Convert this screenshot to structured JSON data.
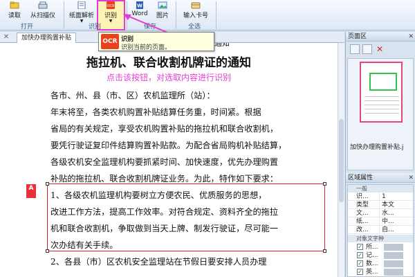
{
  "ribbon": {
    "buttons": [
      {
        "label": "读取",
        "icon": "read-icon"
      },
      {
        "label": "从扫描仪",
        "icon": "scanner-icon"
      },
      {
        "label": "纸面解析",
        "icon": "page-parse-icon"
      },
      {
        "label": "识别",
        "icon": "ocr-icon"
      },
      {
        "label": "Word",
        "icon": "word-icon"
      },
      {
        "label": "图片",
        "icon": "image-icon"
      },
      {
        "label": "输入卡号",
        "icon": "card-icon"
      }
    ],
    "groups": {
      "open": "打开",
      "recognize": "识别",
      "save": "保存",
      "select_all": "全选"
    }
  },
  "tooltip": {
    "badge": "OCR",
    "title": "识别",
    "desc": "识别当前的页面。"
  },
  "tab": {
    "label": "加快办理购置补贴"
  },
  "document": {
    "title": "拖拉机、联合收割机牌证的通知",
    "hint": "点击该按钮，对选取内容进行识别",
    "top_cut": "通知",
    "lines": [
      "各市、州、县（市、区）农机监理所（站）：",
      "    年末将至，各类农机购置补贴结算任务重，时间紧。根据",
      "省局的有关规定，享受农机购置补贴的拖拉机和联合收割机，",
      "要凭行驶证复印件结算购置补贴款。为配合省局购机补贴结算，",
      "各级农机安全监理机构要抓紧时间、加快速度，优先办理购置",
      "补贴的拖拉机、联合收割机牌证业务。为此，特作如下要求：",
      "    1、各级农机监理机构要树立方便农民、优质服务的思想，",
      "改进工作方法，提高工作效率。对符合规定、资料齐全的拖拉",
      "机和联合收割机，争取做到当天上牌、制发行驶证，尽可能一",
      "次办结有关手续。",
      "    2、各县（市）区农机安全监理站在节假日要安排人员办理"
    ],
    "region_badge": "A"
  },
  "right_panel": {
    "pages_title": "页面区",
    "thumb_label": "加快办理购置补贴.j",
    "props_title": "区域属性",
    "section_general": "一般",
    "props": [
      {
        "k": "识...",
        "v": "1"
      },
      {
        "k": "类型",
        "v": "本文"
      },
      {
        "k": "文...",
        "v": "水..."
      },
      {
        "k": "纸...",
        "v": "中..."
      },
      {
        "k": "改...",
        "v": "自..."
      }
    ],
    "section_chars": "对象文字种",
    "checks": [
      {
        "k": "所...",
        "checked": true
      },
      {
        "k": "记...",
        "checked": true
      },
      {
        "k": "数...",
        "checked": true
      },
      {
        "k": "英...",
        "checked": true
      }
    ]
  }
}
